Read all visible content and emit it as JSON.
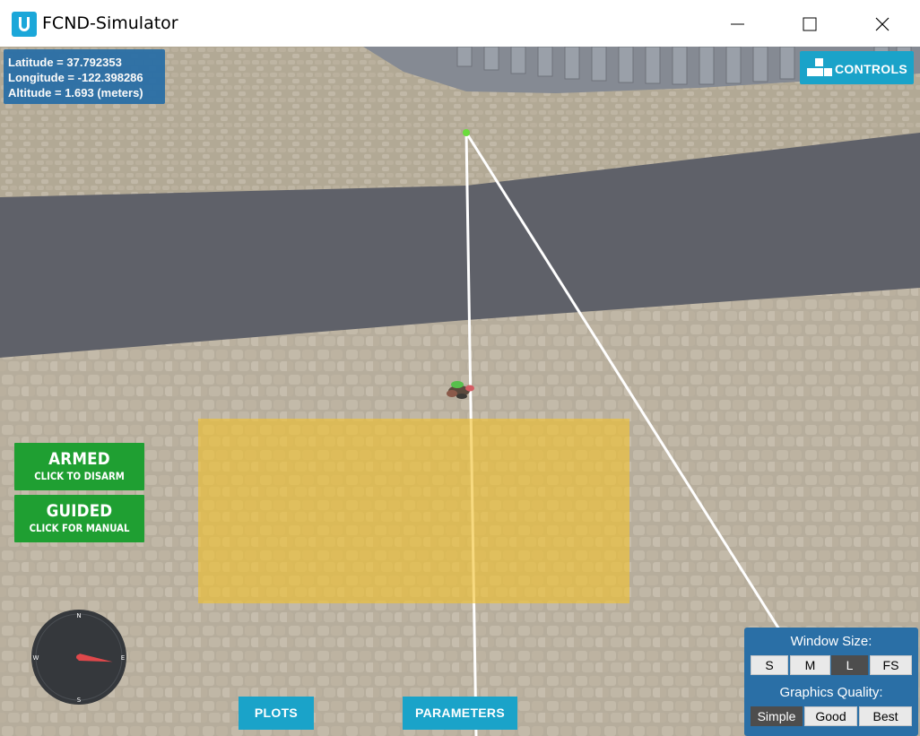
{
  "window": {
    "title": "FCND-Simulator",
    "icons": {
      "app": "unity-u-icon",
      "minimize": "minimize-icon",
      "maximize": "maximize-icon",
      "close": "close-icon"
    }
  },
  "telemetry": {
    "latitude": "Latitude = 37.792353",
    "longitude": "Longitude = -122.398286",
    "altitude": "Altitude = 1.693 (meters)"
  },
  "controls_button": {
    "label": "CONTROLS",
    "icon": "keyboard-keys-icon"
  },
  "armed_button": {
    "title": "ARMED",
    "subtitle": "CLICK TO DISARM"
  },
  "guided_button": {
    "title": "GUIDED",
    "subtitle": "CLICK FOR MANUAL"
  },
  "compass": {
    "n": "N",
    "e": "E",
    "s": "S",
    "w": "W",
    "heading_deg": 98
  },
  "bottom_bar": {
    "plots": "PLOTS",
    "parameters": "PARAMETERS"
  },
  "settings": {
    "window_size_label": "Window Size:",
    "window_sizes": [
      "S",
      "M",
      "L",
      "FS"
    ],
    "window_size_selected": "L",
    "graphics_label": "Graphics Quality:",
    "graphics_options": [
      "Simple",
      "Good",
      "Best"
    ],
    "graphics_selected": "Simple"
  },
  "colors": {
    "accent_blue": "#1aa3c9",
    "panel_blue": "#2a6fa6",
    "armed_green": "#1f9f32",
    "road_gray": "#5f6169",
    "ground_tan": "#b4aa98",
    "target_zone": "#f2c12e"
  }
}
